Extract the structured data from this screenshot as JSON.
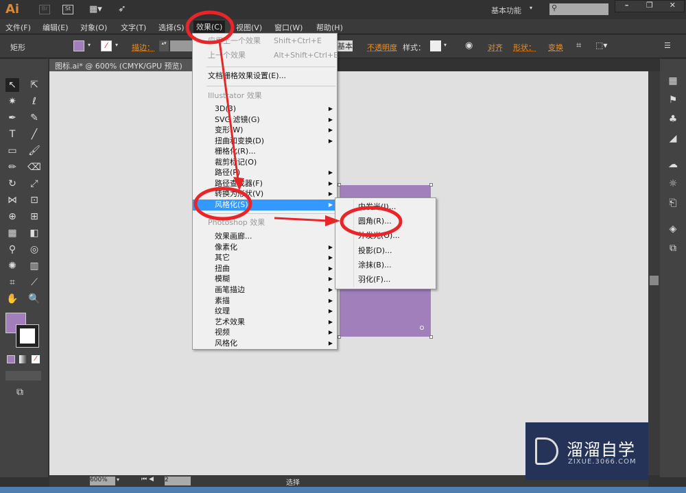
{
  "app": {
    "logo": "Ai",
    "br": "Br",
    "st": "St",
    "workspace": "基本功能"
  },
  "menubar": [
    "文件(F)",
    "编辑(E)",
    "对象(O)",
    "文字(T)",
    "选择(S)",
    "效果(C)",
    "视图(V)",
    "窗口(W)",
    "帮助(H)"
  ],
  "control": {
    "object_type": "矩形",
    "stroke_label": "描边：",
    "basic": "基本",
    "opacity": "不透明度",
    "style": "样式：",
    "align": "对齐",
    "shape": "形状：",
    "transform": "变换",
    "fill_color": "#a07fba"
  },
  "document": {
    "tab": "图标.ai* @ 600% (CMYK/GPU 预览)",
    "rect_color": "#a07fba"
  },
  "effect_menu": {
    "top": [
      {
        "label": "应用上一个效果",
        "shortcut": "Shift+Ctrl+E"
      },
      {
        "label": "上一个效果",
        "shortcut": "Alt+Shift+Ctrl+E"
      }
    ],
    "raster_settings": "文档栅格效果设置(E)...",
    "illustrator_header": "Illustrator 效果",
    "illustrator_items": [
      {
        "label": "3D(3)",
        "sub": true
      },
      {
        "label": "SVG 滤镜(G)",
        "sub": true
      },
      {
        "label": "变形(W)",
        "sub": true
      },
      {
        "label": "扭曲和变换(D)",
        "sub": true
      },
      {
        "label": "栅格化(R)...",
        "sub": false
      },
      {
        "label": "裁剪标记(O)",
        "sub": false
      },
      {
        "label": "路径(P)",
        "sub": true
      },
      {
        "label": "路径查找器(F)",
        "sub": true
      },
      {
        "label": "转换为形状(V)",
        "sub": true
      },
      {
        "label": "风格化(S)",
        "sub": true,
        "highlighted": true
      }
    ],
    "photoshop_header": "Photoshop 效果",
    "photoshop_items": [
      {
        "label": "效果画廊...",
        "sub": false
      },
      {
        "label": "像素化",
        "sub": true
      },
      {
        "label": "其它",
        "sub": true
      },
      {
        "label": "扭曲",
        "sub": true
      },
      {
        "label": "模糊",
        "sub": true
      },
      {
        "label": "画笔描边",
        "sub": true
      },
      {
        "label": "素描",
        "sub": true
      },
      {
        "label": "纹理",
        "sub": true
      },
      {
        "label": "艺术效果",
        "sub": true
      },
      {
        "label": "视频",
        "sub": true
      },
      {
        "label": "风格化",
        "sub": true
      }
    ]
  },
  "stylize_submenu": [
    "内发光(I)...",
    "圆角(R)...",
    "外发光(O)...",
    "投影(D)...",
    "涂抹(B)...",
    "羽化(F)..."
  ],
  "status": {
    "zoom": "600%",
    "artboard": "2",
    "tool": "选择"
  },
  "watermark": {
    "name": "溜溜自学",
    "url": "ZIXUE.3066.COM"
  },
  "annotation_color": "#e8262a"
}
